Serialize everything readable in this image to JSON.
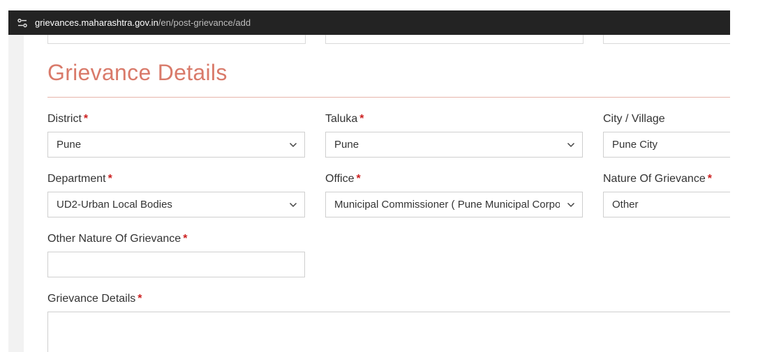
{
  "browser": {
    "url_host": "grievances.maharashtra.gov.in",
    "url_path": "/en/post-grievance/add"
  },
  "section": {
    "title": "Grievance Details"
  },
  "required_mark": "*",
  "fields": {
    "district": {
      "label": "District",
      "value": "Pune"
    },
    "taluka": {
      "label": "Taluka",
      "value": "Pune"
    },
    "city_village": {
      "label": "City / Village",
      "value": "Pune City"
    },
    "department": {
      "label": "Department",
      "value": "UD2-Urban Local Bodies"
    },
    "office": {
      "label": "Office",
      "value": "Municipal Commissioner ( Pune Municipal Corporation )"
    },
    "nature": {
      "label": "Nature Of Grievance",
      "value": "Other"
    },
    "other_nature": {
      "label": "Other Nature Of Grievance",
      "value": ""
    },
    "details": {
      "label": "Grievance Details",
      "value": ""
    }
  },
  "colors": {
    "title": "#d97a6a",
    "required": "#cc1f1f",
    "border": "#cfcfcf",
    "url_bar": "#232323"
  }
}
